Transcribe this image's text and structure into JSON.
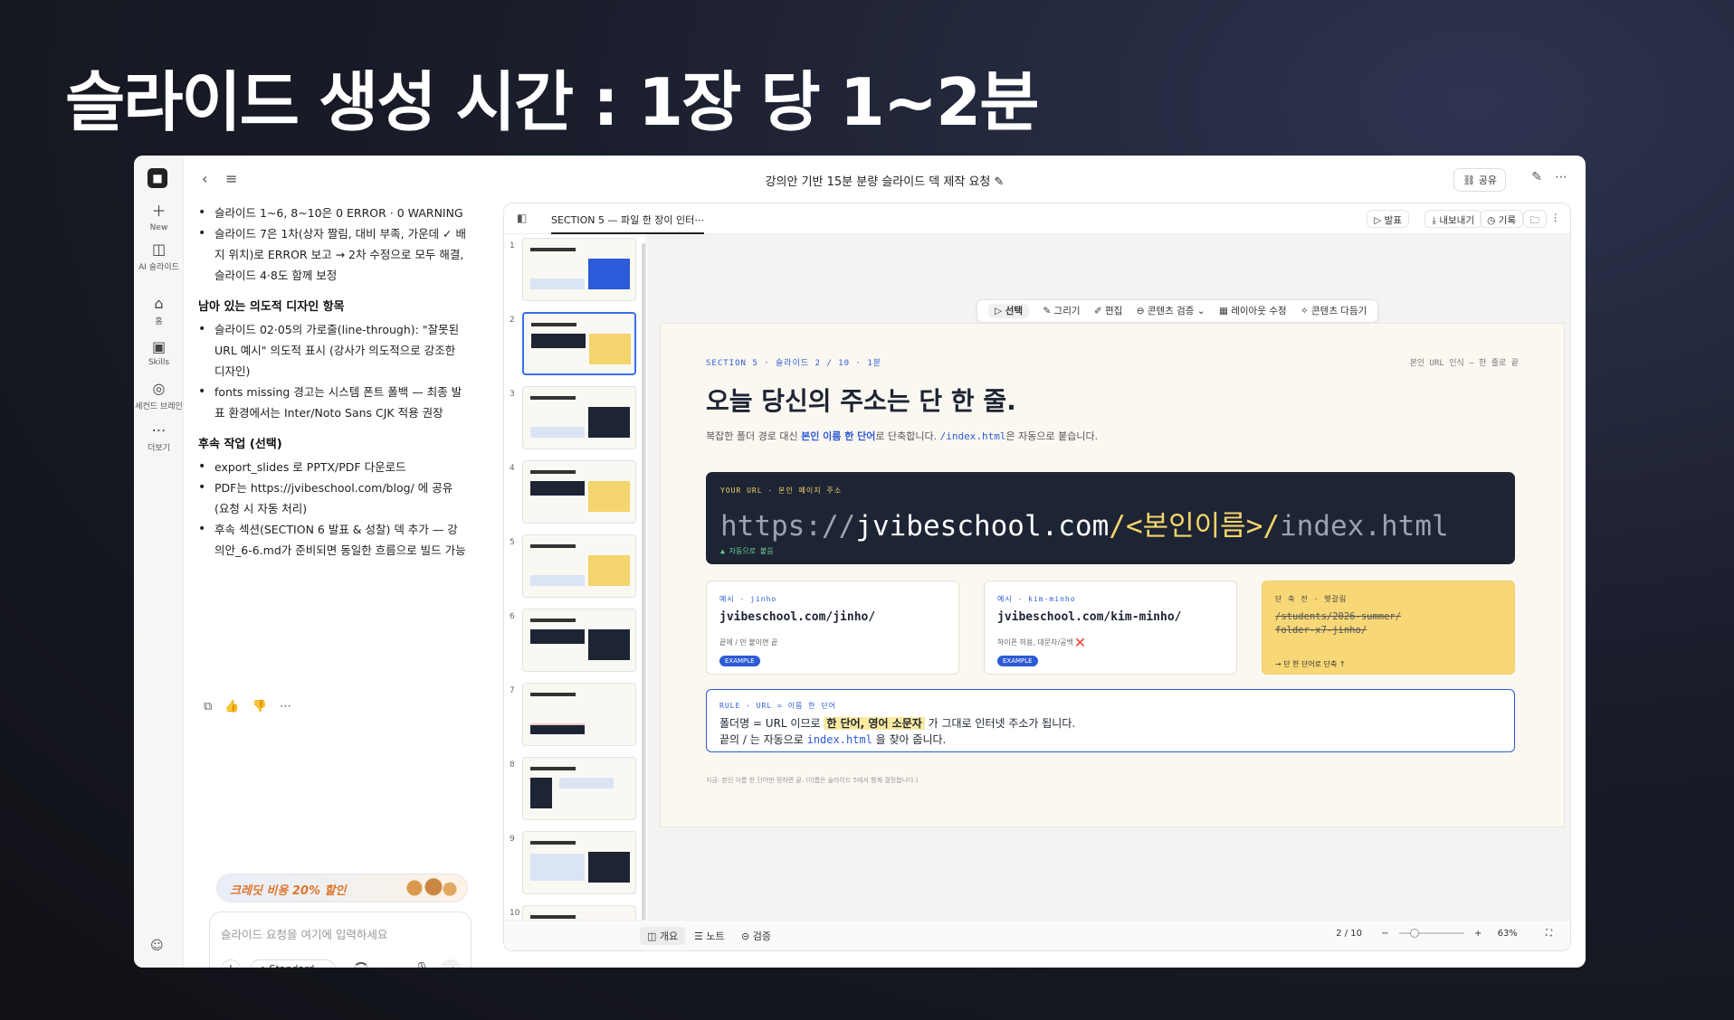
{
  "headline": "슬라이드 생성 시간 : 1장 당 1~2분",
  "rail": {
    "logo": "■",
    "items": [
      {
        "icon": "＋",
        "label": "New"
      },
      {
        "icon": "◫",
        "label": "AI 슬라이드"
      },
      {
        "icon": "⌂",
        "label": "홈"
      },
      {
        "icon": "▣",
        "label": "Skills"
      },
      {
        "icon": "◎",
        "label": "세컨드 브레인"
      },
      {
        "icon": "⋯",
        "label": "더보기"
      }
    ]
  },
  "topbar": {
    "back": "‹",
    "menu": "≡",
    "title": "강의안 기반 15분 분량 슬라이드 덱 제작 요청 ✎",
    "share": "⛓ 공유",
    "edit_icon": "✎",
    "more_icon": "⋯"
  },
  "chat": {
    "top_items": [
      "슬라이드 1~6, 8~10은 0 ERROR · 0 WARNING",
      "슬라이드 7은 1차(상자 짤림, 대비 부족, 가운데 ✓ 배지 위치)로 ERROR 보고 → 2차 수정으로 모두 해결, 슬라이드 4·8도 함께 보정"
    ],
    "section2_title": "남아 있는 의도적 디자인 항목",
    "section2_items": [
      "슬라이드 02·05의 가로줄(line-through): \"잘못된 URL 예시\" 의도적 표시 (강사가 의도적으로 강조한 디자인)",
      "fonts missing 경고는 시스템 폰트 폴백 — 최종 발표 환경에서는 Inter/Noto Sans CJK 적용 권장"
    ],
    "section3_title": "후속 작업 (선택)",
    "section3_items": [
      "export_slides 로 PPTX/PDF 다운로드",
      "PDF는 https://jvibeschool.com/blog/ 에 공유 (요청 시 자동 처리)",
      "후속 섹션(SECTION 6 발표 & 성찰) 덱 추가 — 강의안_6-6.md가 준비되면 동일한 흐름으로 빌드 가능"
    ],
    "actions": "⧉ 👍 👎 ⋯",
    "promo": "크레딧 비용 20% 할인",
    "input_placeholder": "슬라이드 요청을 여기에 입력하세요",
    "plus": "+",
    "model": "⌂ Standard ⌄",
    "mic": "🎙",
    "send": "↵",
    "user_icon": "☺"
  },
  "editor": {
    "side_icon": "◧",
    "tab": "SECTION 5 — 파일 한 장이 인터⋯",
    "buttons": [
      "▷ 발표",
      "⤓ 내보내기",
      "◷ 기록",
      "🗀",
      "⋮"
    ],
    "thumb_numbers": [
      "1",
      "2",
      "3",
      "4",
      "5",
      "6",
      "7",
      "8",
      "9",
      "10"
    ],
    "toolbar": [
      "▷ 선택",
      "✎ 그리기",
      "✐ 편집",
      "⊖ 콘텐츠 검증 ⌄",
      "▦ 레이아웃 수정",
      "✧ 콘텐츠 다듬기"
    ],
    "bottom": [
      "◫ 개요",
      "☰ 노트",
      "⊝ 검증"
    ],
    "page": "2 / 10",
    "zoom_minus": "−",
    "zoom_plus": "+",
    "zoom": "63%",
    "zoom_level": 0.2,
    "fit_icon": "⛶"
  },
  "slide": {
    "kicker": "SECTION 5 · 슬라이드 2 / 10 · 1분",
    "right": "본인 URL 인식 — 한 줄로 끝",
    "title": "오늘 당신의 주소는 단 한 줄.",
    "sub_pre": "복잡한 폴더 경로 대신 ",
    "sub_bold": "본인 이름 한 단어",
    "sub_mid": "로 단축합니다. ",
    "sub_code": "/index.html",
    "sub_post": "은 자동으로 붙습니다.",
    "url_label": "YOUR URL · 본인 페이지 주소",
    "url_dim1": "https://",
    "url_main": "jvibeschool.com",
    "url_hl": "/<본인이름>/",
    "url_dim2": "index.html",
    "url_note": "▲ 자동으로 붙음",
    "cards": [
      {
        "kicker": "예시 · jinho",
        "url": "jvibeschool.com/jinho/",
        "desc": "끝에 / 만 붙이면 끝",
        "tag": "EXAMPLE"
      },
      {
        "kicker": "예시 · kim-minho",
        "url": "jvibeschool.com/kim-minho/",
        "desc": "하이픈 허용, 대문자/공백 ❌",
        "tag": "EXAMPLE"
      }
    ],
    "card3_kicker": "단 축 전 · 헷갈림",
    "card3_strike": "/students/2026-summer/\nfolder-x7-jinho/",
    "card3_end": "→ 단 한 단어로 단축 ↑",
    "rule_kicker": "RULE · URL = 이름 한 단어",
    "rule_l1_pre": "폴더명 = URL 이므로 ",
    "rule_l1_mark": "한 단어, 영어 소문자",
    "rule_l1_post": " 가 그대로 인터넷 주소가 됩니다.",
    "rule_l2_pre": "끝의 / 는 자동으로 ",
    "rule_l2_code": "index.html",
    "rule_l2_post": " 을 찾아 줍니다.",
    "foot": "지금: 본인 이름 한 단어만 정하면 끝. (이름은 슬라이드 5에서 함께 결정합니다.)"
  },
  "colors": {
    "accent": "#2d5bd6",
    "dark": "#1d2433",
    "yellow": "#f8d776"
  }
}
